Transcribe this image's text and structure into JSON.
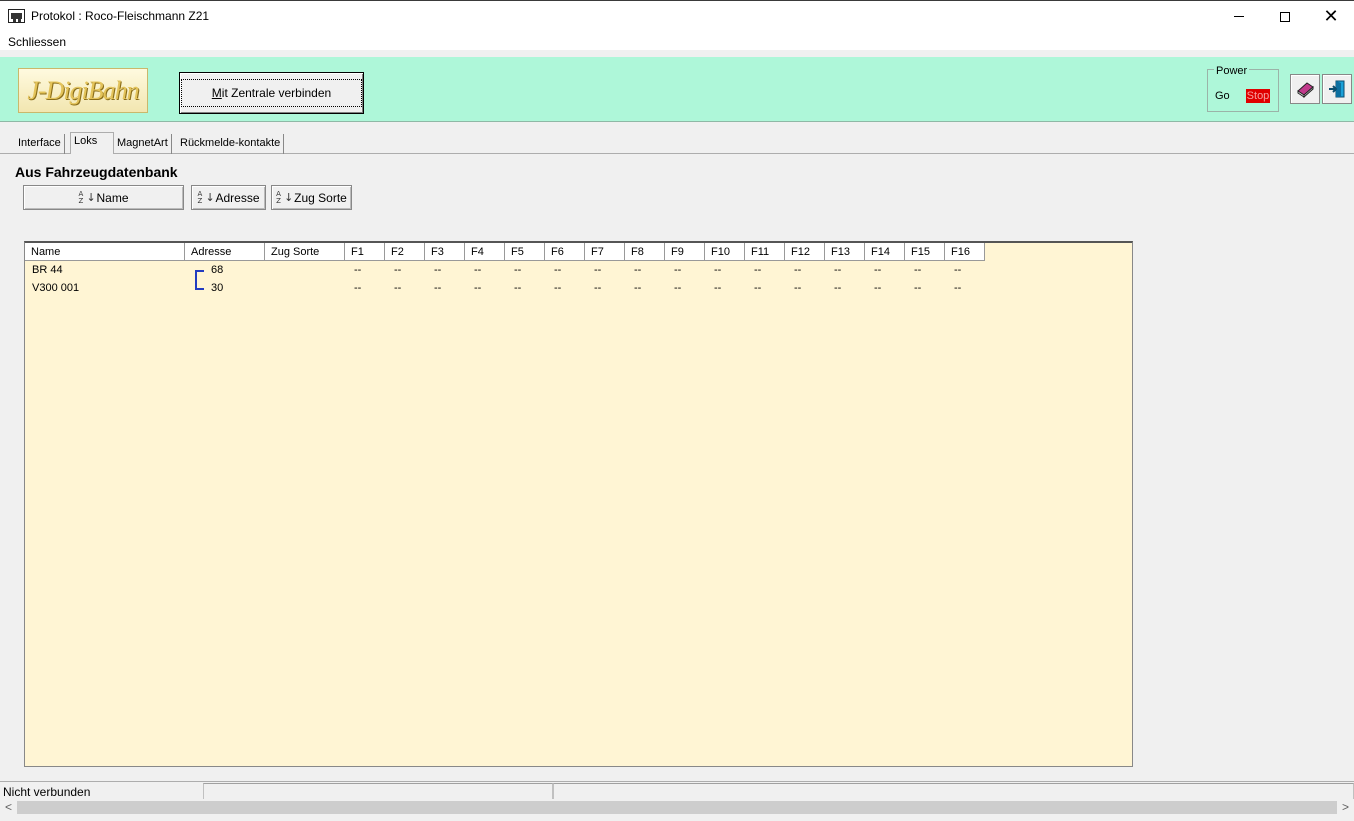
{
  "window": {
    "title": "Protokol : Roco-Fleischmann Z21"
  },
  "menu": {
    "items": [
      "Schliessen"
    ]
  },
  "toolbar": {
    "logo_text": "J-DigiBahn",
    "connect_label_prefix": "M",
    "connect_label_rest": "it Zentrale verbinden",
    "power": {
      "legend": "Power",
      "go": "Go",
      "stop": "Stop",
      "stop_color": "#e00000"
    },
    "icons": [
      "book-icon",
      "exit-door-icon"
    ],
    "background": "#aef7d9"
  },
  "tabs": [
    {
      "label": "Interface",
      "active": false
    },
    {
      "label": "Loks",
      "active": true
    },
    {
      "label": "MagnetArt",
      "active": false
    },
    {
      "label": "Rückmelde-kontakte",
      "active": false
    }
  ],
  "section": {
    "title": "Aus Fahrzeugdatenbank"
  },
  "sort_buttons": [
    {
      "label": "Name",
      "icon": "sort-az-icon"
    },
    {
      "label": "Adresse",
      "icon": "sort-az-icon"
    },
    {
      "label": "Zug Sorte",
      "icon": "sort-az-icon"
    }
  ],
  "grid": {
    "background": "#fff5d4",
    "columns": [
      "Name",
      "Adresse",
      "Zug Sorte",
      "F1",
      "F2",
      "F3",
      "F4",
      "F5",
      "F6",
      "F7",
      "F8",
      "F9",
      "F10",
      "F11",
      "F12",
      "F13",
      "F14",
      "F15",
      "F16"
    ],
    "rows": [
      {
        "name": "BR 44",
        "adresse": "68",
        "zug_sorte": "",
        "f": [
          "--",
          "--",
          "--",
          "--",
          "--",
          "--",
          "--",
          "--",
          "--",
          "--",
          "--",
          "--",
          "--",
          "--",
          "--",
          "--"
        ]
      },
      {
        "name": "V300 001",
        "adresse": "30",
        "zug_sorte": "",
        "f": [
          "--",
          "--",
          "--",
          "--",
          "--",
          "--",
          "--",
          "--",
          "--",
          "--",
          "--",
          "--",
          "--",
          "--",
          "--",
          "--"
        ]
      }
    ]
  },
  "status": {
    "panes": [
      "Nicht verbunden",
      "",
      ""
    ]
  }
}
